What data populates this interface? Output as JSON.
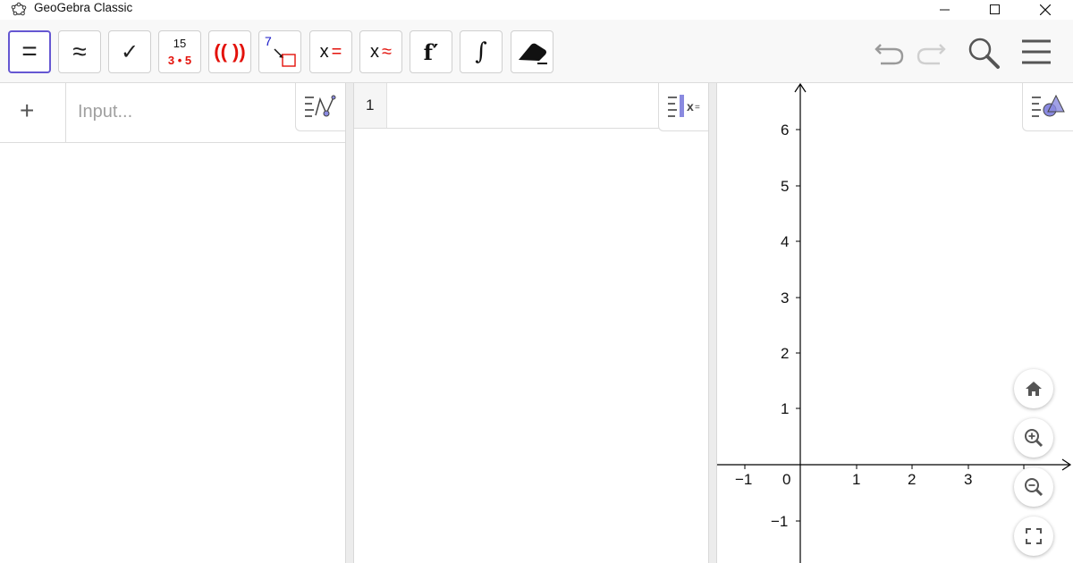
{
  "window": {
    "title": "GeoGebra Classic"
  },
  "toolbar": {
    "tools": [
      {
        "id": "evaluate",
        "label": "="
      },
      {
        "id": "numeric",
        "label": "≈"
      },
      {
        "id": "keep-input",
        "label": "✓"
      },
      {
        "id": "factor",
        "top": "15",
        "bottom": "3 • 5"
      },
      {
        "id": "expand",
        "label": "(( ))"
      },
      {
        "id": "substitute",
        "top": "7"
      },
      {
        "id": "solve",
        "label": "x",
        "sign": "="
      },
      {
        "id": "solve-numerically",
        "label": "x",
        "sign": "≈"
      },
      {
        "id": "derivative",
        "label": "f′"
      },
      {
        "id": "integral",
        "label": "∫"
      },
      {
        "id": "delete",
        "label": ""
      }
    ],
    "selected_tool": "evaluate"
  },
  "algebra": {
    "input_placeholder": "Input..."
  },
  "cas": {
    "row_number": "1"
  },
  "graphics": {
    "axis_color": "#000000",
    "x_ticks": [
      "−1",
      "0",
      "1",
      "2",
      "3"
    ],
    "y_ticks": [
      "6",
      "5",
      "4",
      "3",
      "2",
      "1",
      "−1"
    ]
  },
  "colors": {
    "accent": "#6557d2",
    "red": "#e3120b",
    "blue": "#1515c7"
  }
}
